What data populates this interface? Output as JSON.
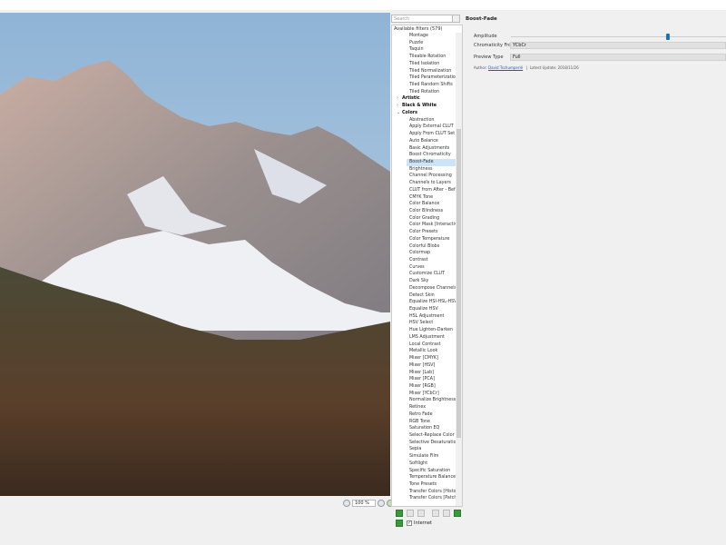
{
  "search": {
    "placeholder": "Search"
  },
  "filters": {
    "header": "Available filters (579)",
    "rows": [
      {
        "label": "Montage",
        "type": "item"
      },
      {
        "label": "Puzzle",
        "type": "item"
      },
      {
        "label": "Taquin",
        "type": "item"
      },
      {
        "label": "Tileable Rotation",
        "type": "item"
      },
      {
        "label": "Tiled Isolation",
        "type": "item"
      },
      {
        "label": "Tiled Normalization",
        "type": "item"
      },
      {
        "label": "Tiled Parameterization",
        "type": "item"
      },
      {
        "label": "Tiled Random Shifts",
        "type": "item"
      },
      {
        "label": "Tiled Rotation",
        "type": "item"
      },
      {
        "label": "Artistic",
        "type": "cat",
        "open": false
      },
      {
        "label": "Black & White",
        "type": "cat",
        "open": false
      },
      {
        "label": "Colors",
        "type": "cat",
        "open": true
      },
      {
        "label": "Abstraction",
        "type": "item"
      },
      {
        "label": "Apply External CLUT",
        "type": "item"
      },
      {
        "label": "Apply From CLUT Set",
        "type": "item"
      },
      {
        "label": "Auto Balance",
        "type": "item"
      },
      {
        "label": "Basic Adjustments",
        "type": "item"
      },
      {
        "label": "Boost Chromaticity",
        "type": "item"
      },
      {
        "label": "Boost-Fade",
        "type": "item",
        "selected": true
      },
      {
        "label": "Brightness",
        "type": "item"
      },
      {
        "label": "Channel Processing",
        "type": "item"
      },
      {
        "label": "Channels to Layers",
        "type": "item"
      },
      {
        "label": "CLUT from After - Before Layers",
        "type": "item"
      },
      {
        "label": "CMYK Tone",
        "type": "item"
      },
      {
        "label": "Color Balance",
        "type": "item"
      },
      {
        "label": "Color Blindness",
        "type": "item"
      },
      {
        "label": "Color Grading",
        "type": "item"
      },
      {
        "label": "Color Mask [Interactive]",
        "type": "item"
      },
      {
        "label": "Color Presets",
        "type": "item"
      },
      {
        "label": "Color Temperature",
        "type": "item"
      },
      {
        "label": "Colorful Blobs",
        "type": "item"
      },
      {
        "label": "Colormap",
        "type": "item"
      },
      {
        "label": "Contrast",
        "type": "item"
      },
      {
        "label": "Curves",
        "type": "item"
      },
      {
        "label": "Customize CLUT",
        "type": "item"
      },
      {
        "label": "Dark Sky",
        "type": "item"
      },
      {
        "label": "Decompose Channels",
        "type": "item"
      },
      {
        "label": "Detect Skin",
        "type": "item"
      },
      {
        "label": "Equalize HSI-HSL-HSV",
        "type": "item"
      },
      {
        "label": "Equalize HSV",
        "type": "item"
      },
      {
        "label": "HSL Adjustment",
        "type": "item"
      },
      {
        "label": "HSV Select",
        "type": "item"
      },
      {
        "label": "Hue Lighten-Darken",
        "type": "item"
      },
      {
        "label": "LMS Adjustment",
        "type": "item"
      },
      {
        "label": "Local Contrast",
        "type": "item"
      },
      {
        "label": "Metallic Look",
        "type": "item"
      },
      {
        "label": "Mixer [CMYK]",
        "type": "item"
      },
      {
        "label": "Mixer [HSV]",
        "type": "item"
      },
      {
        "label": "Mixer [Lab]",
        "type": "item"
      },
      {
        "label": "Mixer [PCA]",
        "type": "item"
      },
      {
        "label": "Mixer [RGB]",
        "type": "item"
      },
      {
        "label": "Mixer [YCbCr]",
        "type": "item"
      },
      {
        "label": "Normalize Brightness",
        "type": "item"
      },
      {
        "label": "Retinex",
        "type": "item"
      },
      {
        "label": "Retro Fade",
        "type": "item"
      },
      {
        "label": "RGB Tone",
        "type": "item"
      },
      {
        "label": "Saturation EQ",
        "type": "item"
      },
      {
        "label": "Select-Replace Color",
        "type": "item"
      },
      {
        "label": "Selective Desaturation",
        "type": "item"
      },
      {
        "label": "Sepia",
        "type": "item"
      },
      {
        "label": "Simulate Film",
        "type": "item"
      },
      {
        "label": "Softlight",
        "type": "item"
      },
      {
        "label": "Specific Saturation",
        "type": "item"
      },
      {
        "label": "Temperature Balance",
        "type": "item"
      },
      {
        "label": "Tone Presets",
        "type": "item"
      },
      {
        "label": "Transfer Colors [Histogram]",
        "type": "item"
      },
      {
        "label": "Transfer Colors [Patch-Based]",
        "type": "item"
      }
    ]
  },
  "zoom": {
    "value": "100 %"
  },
  "filter_panel": {
    "title": "Boost-Fade",
    "amplitude_label": "Amplitude",
    "amplitude_fraction": 0.73,
    "chromaticity_label": "Chromaticity From",
    "chromaticity_value": "YCbCr",
    "preview_label": "Preview Type",
    "preview_value": "Full",
    "author_label": "Author:",
    "author_name": "David Tschumperlé",
    "update_label": "Latest Update:",
    "update_value": "2018/11/26"
  },
  "bottom": {
    "internet_label": "Internet",
    "internet_checked": true
  },
  "colors": {
    "accent": "#1a73c0",
    "selection": "#cce4f7"
  }
}
